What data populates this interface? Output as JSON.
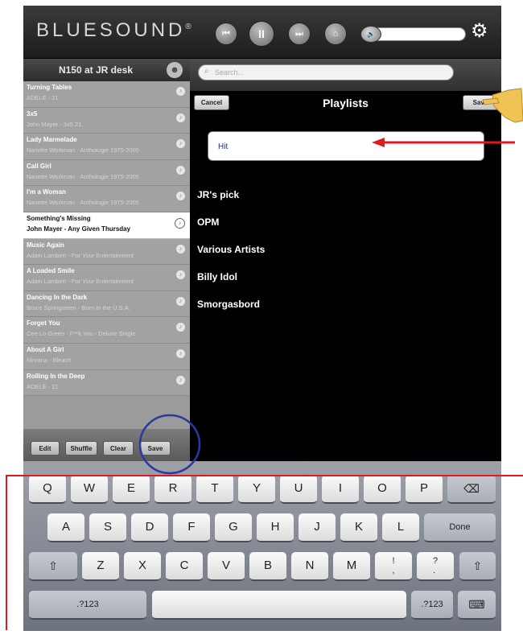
{
  "header": {
    "brand": "BLUESOUND",
    "brand_mark": "®",
    "controls": {
      "prev": "⏮",
      "pause": "II",
      "next": "⏭",
      "home": "⌂",
      "volume_icon": "🔊",
      "settings": "⚙"
    },
    "volume_level": 0.05
  },
  "sidebar": {
    "player_name": "N150 at JR desk",
    "user_icon": "☻",
    "queue": [
      {
        "title": "Turning Tables",
        "subtitle": "ADELE - 21",
        "current": false
      },
      {
        "title": "3x5",
        "subtitle": "John Mayer - 3x5 21",
        "current": false
      },
      {
        "title": "Lady Marmelade",
        "subtitle": "Nanette Workman - Anthologie 1975-2005",
        "current": false
      },
      {
        "title": "Call Girl",
        "subtitle": "Nanette Workman - Anthologie 1975-2005",
        "current": false
      },
      {
        "title": "I'm a Woman",
        "subtitle": "Nanette Workman - Anthologie 1975-2005",
        "current": false
      },
      {
        "title": "Something's Missing",
        "subtitle": "John Mayer - Any Given Thursday",
        "current": true
      },
      {
        "title": "Music Again",
        "subtitle": "Adam Lambert - For Your Entertainment",
        "current": false
      },
      {
        "title": "A Loaded Smile",
        "subtitle": "Adam Lambert - For Your Entertainment",
        "current": false
      },
      {
        "title": "Dancing In the Dark",
        "subtitle": "Bruce Springsteen - Born In the U.S.A.",
        "current": false
      },
      {
        "title": "Forget You",
        "subtitle": "Cee Lo Green - F**k You - Deluxe Single",
        "current": false
      },
      {
        "title": "About A Girl",
        "subtitle": "Nirvana - Bleach",
        "current": false
      },
      {
        "title": "Rolling In the Deep",
        "subtitle": "ADELE - 21",
        "current": false
      }
    ],
    "buttons": {
      "edit": "Edit",
      "shuffle": "Shuffle",
      "clear": "Clear",
      "save": "Save"
    }
  },
  "search": {
    "placeholder": "Search...",
    "icon": "⌕",
    "value": ""
  },
  "playlists": {
    "title": "Playlists",
    "cancel": "Cancel",
    "save": "Save",
    "name_value": "Hit",
    "items": [
      "JR's pick",
      "OPM",
      "Various Artists",
      "Billy Idol",
      "Smorgasbord"
    ]
  },
  "keyboard": {
    "row1": [
      "Q",
      "W",
      "E",
      "R",
      "T",
      "Y",
      "U",
      "I",
      "O",
      "P"
    ],
    "backspace": "⌫",
    "row2": [
      "A",
      "S",
      "D",
      "F",
      "G",
      "H",
      "J",
      "K",
      "L"
    ],
    "done": "Done",
    "shift": "⇧",
    "row3": [
      "Z",
      "X",
      "C",
      "V",
      "B",
      "N",
      "M",
      "!\n,",
      "?\n."
    ],
    "numbers": ".?123",
    "keyboard_icon": "⌨"
  },
  "annotation": {
    "pointer_hand": "☚",
    "colors": {
      "arrow": "#e0191f",
      "circle": "#2a3aa0",
      "frame_line": "#e0191f"
    }
  }
}
